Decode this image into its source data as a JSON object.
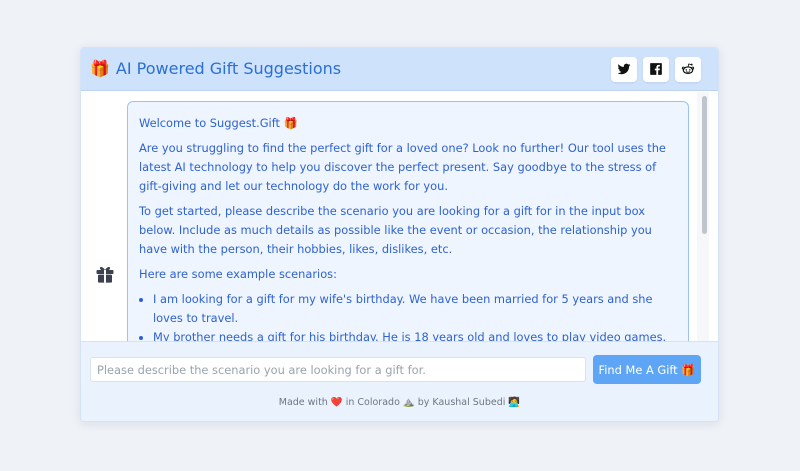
{
  "header": {
    "title": "AI Powered Gift Suggestions",
    "title_icon": "🎁",
    "share_buttons": [
      "twitter-icon",
      "facebook-icon",
      "reddit-icon"
    ]
  },
  "chat": {
    "greeting": "Welcome to Suggest.Gift 🎁",
    "intro": "Are you struggling to find the perfect gift for a loved one? Look no further! Our tool uses the latest AI technology to help you discover the perfect present. Say goodbye to the stress of gift-giving and let our technology do the work for you.",
    "instructions": "To get started, please describe the scenario you are looking for a gift for in the input box below. Include as much details as possible like the event or occasion, the relationship you have with the person, their hobbies, likes, dislikes, etc.",
    "examples_heading": "Here are some example scenarios:",
    "examples": [
      "I am looking for a gift for my wife's birthday. We have been married for 5 years and she loves to travel.",
      "My brother needs a gift for his birthday. He is 18 years old and loves to play video games. He"
    ]
  },
  "input": {
    "placeholder": "Please describe the scenario you are looking for a gift for.",
    "value": ""
  },
  "submit_label": "Find Me A Gift 🎁",
  "credit": {
    "made_with": "Made with",
    "heart": "❤️",
    "in": "in Colorado ⛰️ by Kaushal Subedi 🧑‍💻"
  },
  "colors": {
    "accent": "#2a6fd6",
    "header_bg": "#cfe2fb",
    "button_bg": "#5ea5f5",
    "bubble_bg": "#eef5ff",
    "bubble_border": "#9ec2f0"
  }
}
